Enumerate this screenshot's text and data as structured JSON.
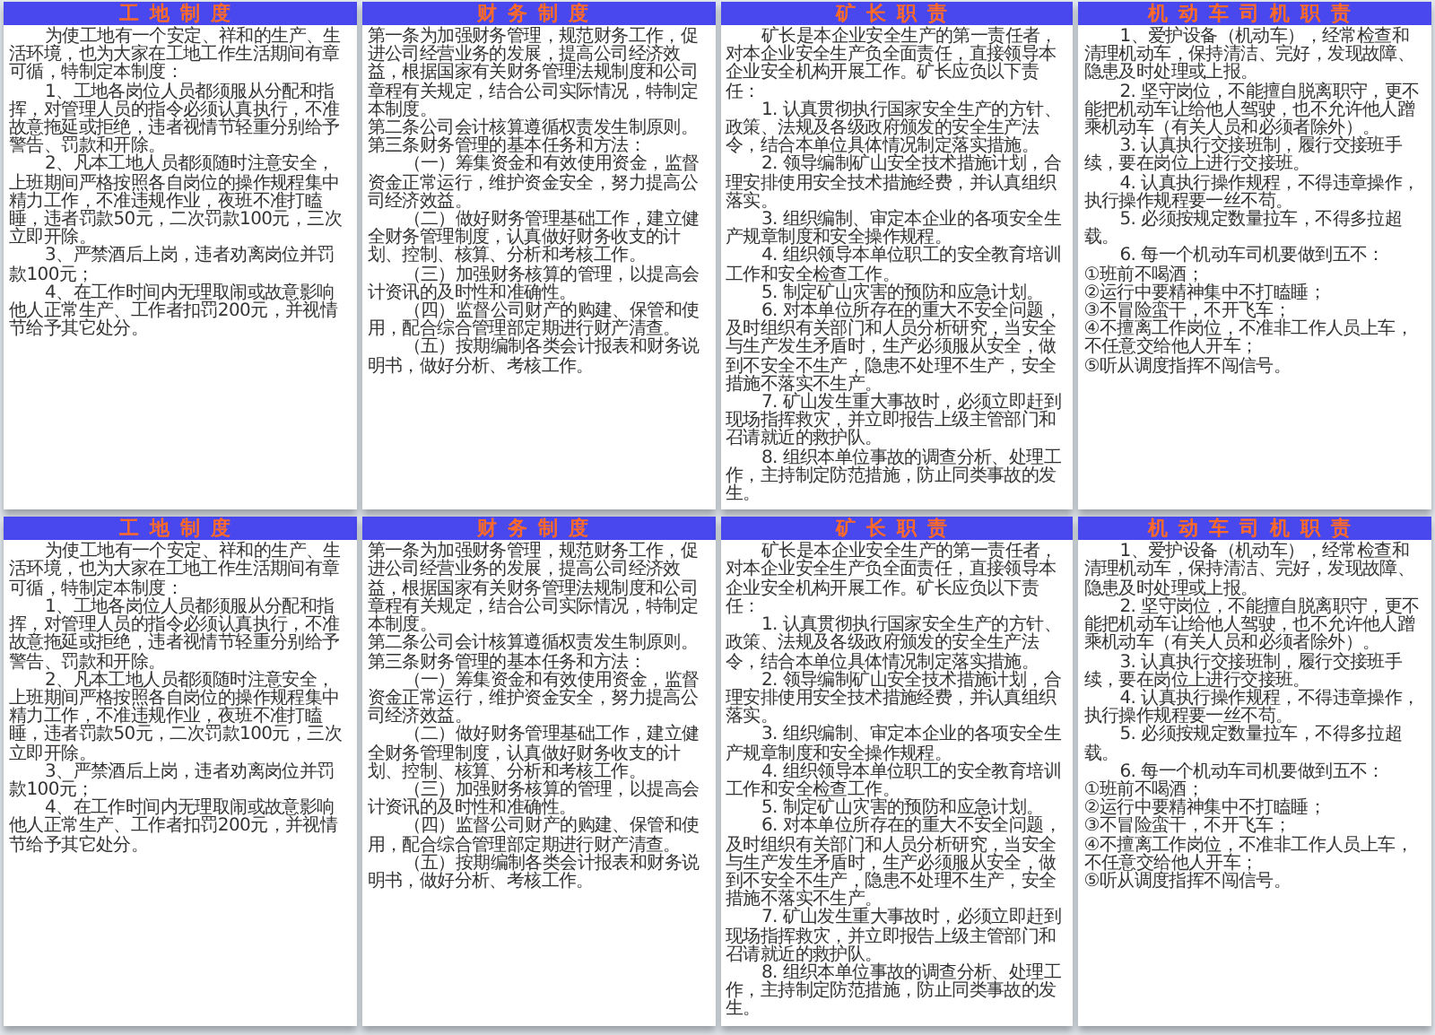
{
  "rows": [
    {
      "panels": [
        {
          "title": "工地制度",
          "paragraphs": [
            {
              "kind": "indented",
              "text": "为使工地有一个安定、祥和的生产、生活环境，也为大家在工地工作生活期间有章可循，特制定本制度："
            },
            {
              "kind": "indented",
              "text": "1、工地各岗位人员都须服从分配和指挥，对管理人员的指令必须认真执行，不准故意拖延或拒绝，违者视情节轻重分别给予警告、罚款和开除。"
            },
            {
              "kind": "indented",
              "text": "2、凡本工地人员都须随时注意安全，上班期间严格按照各自岗位的操作规程集中精力工作，不准违规作业，夜班不准打瞌睡，违者罚款50元，二次罚款100元，三次立即开除。"
            },
            {
              "kind": "indented",
              "text": "3、严禁酒后上岗，违者劝离岗位并罚款100元；"
            },
            {
              "kind": "indented",
              "text": "4、在工作时间内无理取闹或故意影响他人正常生产、工作者扣罚200元，并视情节给予其它处分。"
            }
          ]
        },
        {
          "title": "财务制度",
          "paragraphs": [
            {
              "kind": "plain",
              "text": "第一条为加强财务管理，规范财务工作，促进公司经营业务的发展，提高公司经济效益，根据国家有关财务管理法规制度和公司章程有关规定，结合公司实际情况，特制定本制度。"
            },
            {
              "kind": "plain",
              "text": "第二条公司会计核算遵循权责发生制原则。"
            },
            {
              "kind": "plain",
              "text": "第三条财务管理的基本任务和方法："
            },
            {
              "kind": "indented",
              "text": "（一）筹集资金和有效使用资金，监督资金正常运行，维护资金安全，努力提高公司经济效益。"
            },
            {
              "kind": "indented",
              "text": "（二）做好财务管理基础工作，建立健全财务管理制度，认真做好财务收支的计划、控制、核算、分析和考核工作。"
            },
            {
              "kind": "indented",
              "text": "（三）加强财务核算的管理，以提高会计资讯的及时性和准确性。"
            },
            {
              "kind": "indented",
              "text": "（四）监督公司财产的购建、保管和使用，配合综合管理部定期进行财产清查。"
            },
            {
              "kind": "indented",
              "text": "（五）按期编制各类会计报表和财务说明书，做好分析、考核工作。"
            }
          ]
        },
        {
          "title": "矿长职责",
          "paragraphs": [
            {
              "kind": "indented",
              "text": "矿长是本企业安全生产的第一责任者，对本企业安全生产负全面责任，直接领导本企业安全机构开展工作。矿长应负以下责任："
            },
            {
              "kind": "indented",
              "text": "1. 认真贯彻执行国家安全生产的方针、政策、法规及各级政府颁发的安全生产法令，结合本单位具体情况制定落实措施。"
            },
            {
              "kind": "indented",
              "text": "2. 领导编制矿山安全技术措施计划，合理安排使用安全技术措施经费，并认真组织落实。"
            },
            {
              "kind": "indented",
              "text": "3. 组织编制、审定本企业的各项安全生产规章制度和安全操作规程。"
            },
            {
              "kind": "indented",
              "text": "4. 组织领导本单位职工的安全教育培训工作和安全检查工作。"
            },
            {
              "kind": "indented",
              "text": "5. 制定矿山灾害的预防和应急计划。"
            },
            {
              "kind": "indented",
              "text": "6. 对本单位所存在的重大不安全问题，及时组织有关部门和人员分析研究，当安全与生产发生矛盾时，生产必须服从安全，做到不安全不生产，隐患不处理不生产，安全措施不落实不生产。"
            },
            {
              "kind": "indented",
              "text": "7. 矿山发生重大事故时，必须立即赶到现场指挥救灾，并立即报告上级主管部门和召请就近的救护队。"
            },
            {
              "kind": "indented",
              "text": "8. 组织本单位事故的调查分析、处理工作，主持制定防范措施，防止同类事故的发生。"
            }
          ]
        },
        {
          "title": "机动车司机职责",
          "paragraphs": [
            {
              "kind": "indented",
              "text": "1、爱护设备（机动车），经常检查和清理机动车，保持清洁、完好，发现故障、隐患及时处理或上报。"
            },
            {
              "kind": "indented",
              "text": "2. 坚守岗位，不能擅自脱离职守，更不能把机动车让给他人驾驶，也不允许他人蹭乘机动车（有关人员和必须者除外）。"
            },
            {
              "kind": "indented",
              "text": "3. 认真执行交接班制，履行交接班手续，要在岗位上进行交接班。"
            },
            {
              "kind": "indented",
              "text": "4. 认真执行操作规程，不得违章操作，执行操作规程要一丝不苟。"
            },
            {
              "kind": "indented",
              "text": "5. 必须按规定数量拉车，不得多拉超载。"
            },
            {
              "kind": "indented",
              "text": "6. 每一个机动车司机要做到五不："
            },
            {
              "kind": "plain",
              "text": "①班前不喝酒；"
            },
            {
              "kind": "plain",
              "text": "②运行中要精神集中不打瞌睡；"
            },
            {
              "kind": "plain",
              "text": "③不冒险蛮干，不开飞车；"
            },
            {
              "kind": "plain",
              "text": "④不擅离工作岗位，不准非工作人员上车，不任意交给他人开车；"
            },
            {
              "kind": "plain",
              "text": "⑤听从调度指挥不闯信号。"
            }
          ]
        }
      ]
    },
    {
      "panels": [
        {
          "title": "工地制度",
          "paragraphs": [
            {
              "kind": "indented",
              "text": "为使工地有一个安定、祥和的生产、生活环境，也为大家在工地工作生活期间有章可循，特制定本制度："
            },
            {
              "kind": "indented",
              "text": "1、工地各岗位人员都须服从分配和指挥，对管理人员的指令必须认真执行，不准故意拖延或拒绝，违者视情节轻重分别给予警告、罚款和开除。"
            },
            {
              "kind": "indented",
              "text": "2、凡本工地人员都须随时注意安全，上班期间严格按照各自岗位的操作规程集中精力工作，不准违规作业，夜班不准打瞌睡，违者罚款50元，二次罚款100元，三次立即开除。"
            },
            {
              "kind": "indented",
              "text": "3、严禁酒后上岗，违者劝离岗位并罚款100元；"
            },
            {
              "kind": "indented",
              "text": "4、在工作时间内无理取闹或故意影响他人正常生产、工作者扣罚200元，并视情节给予其它处分。"
            }
          ]
        },
        {
          "title": "财务制度",
          "paragraphs": [
            {
              "kind": "plain",
              "text": "第一条为加强财务管理，规范财务工作，促进公司经营业务的发展，提高公司经济效益，根据国家有关财务管理法规制度和公司章程有关规定，结合公司实际情况，特制定本制度。"
            },
            {
              "kind": "plain",
              "text": "第二条公司会计核算遵循权责发生制原则。"
            },
            {
              "kind": "plain",
              "text": "第三条财务管理的基本任务和方法："
            },
            {
              "kind": "indented",
              "text": "（一）筹集资金和有效使用资金，监督资金正常运行，维护资金安全，努力提高公司经济效益。"
            },
            {
              "kind": "indented",
              "text": "（二）做好财务管理基础工作，建立健全财务管理制度，认真做好财务收支的计划、控制、核算、分析和考核工作。"
            },
            {
              "kind": "indented",
              "text": "（三）加强财务核算的管理，以提高会计资讯的及时性和准确性。"
            },
            {
              "kind": "indented",
              "text": "（四）监督公司财产的购建、保管和使用，配合综合管理部定期进行财产清查。"
            },
            {
              "kind": "indented",
              "text": "（五）按期编制各类会计报表和财务说明书，做好分析、考核工作。"
            }
          ]
        },
        {
          "title": "矿长职责",
          "paragraphs": [
            {
              "kind": "indented",
              "text": "矿长是本企业安全生产的第一责任者，对本企业安全生产负全面责任，直接领导本企业安全机构开展工作。矿长应负以下责任："
            },
            {
              "kind": "indented",
              "text": "1. 认真贯彻执行国家安全生产的方针、政策、法规及各级政府颁发的安全生产法令，结合本单位具体情况制定落实措施。"
            },
            {
              "kind": "indented",
              "text": "2. 领导编制矿山安全技术措施计划，合理安排使用安全技术措施经费，并认真组织落实。"
            },
            {
              "kind": "indented",
              "text": "3. 组织编制、审定本企业的各项安全生产规章制度和安全操作规程。"
            },
            {
              "kind": "indented",
              "text": "4. 组织领导本单位职工的安全教育培训工作和安全检查工作。"
            },
            {
              "kind": "indented",
              "text": "5. 制定矿山灾害的预防和应急计划。"
            },
            {
              "kind": "indented",
              "text": "6. 对本单位所存在的重大不安全问题，及时组织有关部门和人员分析研究，当安全与生产发生矛盾时，生产必须服从安全，做到不安全不生产，隐患不处理不生产，安全措施不落实不生产。"
            },
            {
              "kind": "indented",
              "text": "7. 矿山发生重大事故时，必须立即赶到现场指挥救灾，并立即报告上级主管部门和召请就近的救护队。"
            },
            {
              "kind": "indented",
              "text": "8. 组织本单位事故的调查分析、处理工作，主持制定防范措施，防止同类事故的发生。"
            }
          ]
        },
        {
          "title": "机动车司机职责",
          "paragraphs": [
            {
              "kind": "indented",
              "text": "1、爱护设备（机动车），经常检查和清理机动车，保持清洁、完好，发现故障、隐患及时处理或上报。"
            },
            {
              "kind": "indented",
              "text": "2. 坚守岗位，不能擅自脱离职守，更不能把机动车让给他人驾驶，也不允许他人蹭乘机动车（有关人员和必须者除外）。"
            },
            {
              "kind": "indented",
              "text": "3. 认真执行交接班制，履行交接班手续，要在岗位上进行交接班。"
            },
            {
              "kind": "indented",
              "text": "4. 认真执行操作规程，不得违章操作，执行操作规程要一丝不苟。"
            },
            {
              "kind": "indented",
              "text": "5. 必须按规定数量拉车，不得多拉超载。"
            },
            {
              "kind": "indented",
              "text": "6. 每一个机动车司机要做到五不："
            },
            {
              "kind": "plain",
              "text": "①班前不喝酒；"
            },
            {
              "kind": "plain",
              "text": "②运行中要精神集中不打瞌睡；"
            },
            {
              "kind": "plain",
              "text": "③不冒险蛮干，不开飞车；"
            },
            {
              "kind": "plain",
              "text": "④不擅离工作岗位，不准非工作人员上车，不任意交给他人开车；"
            },
            {
              "kind": "plain",
              "text": "⑤听从调度指挥不闯信号。"
            }
          ]
        }
      ]
    }
  ]
}
